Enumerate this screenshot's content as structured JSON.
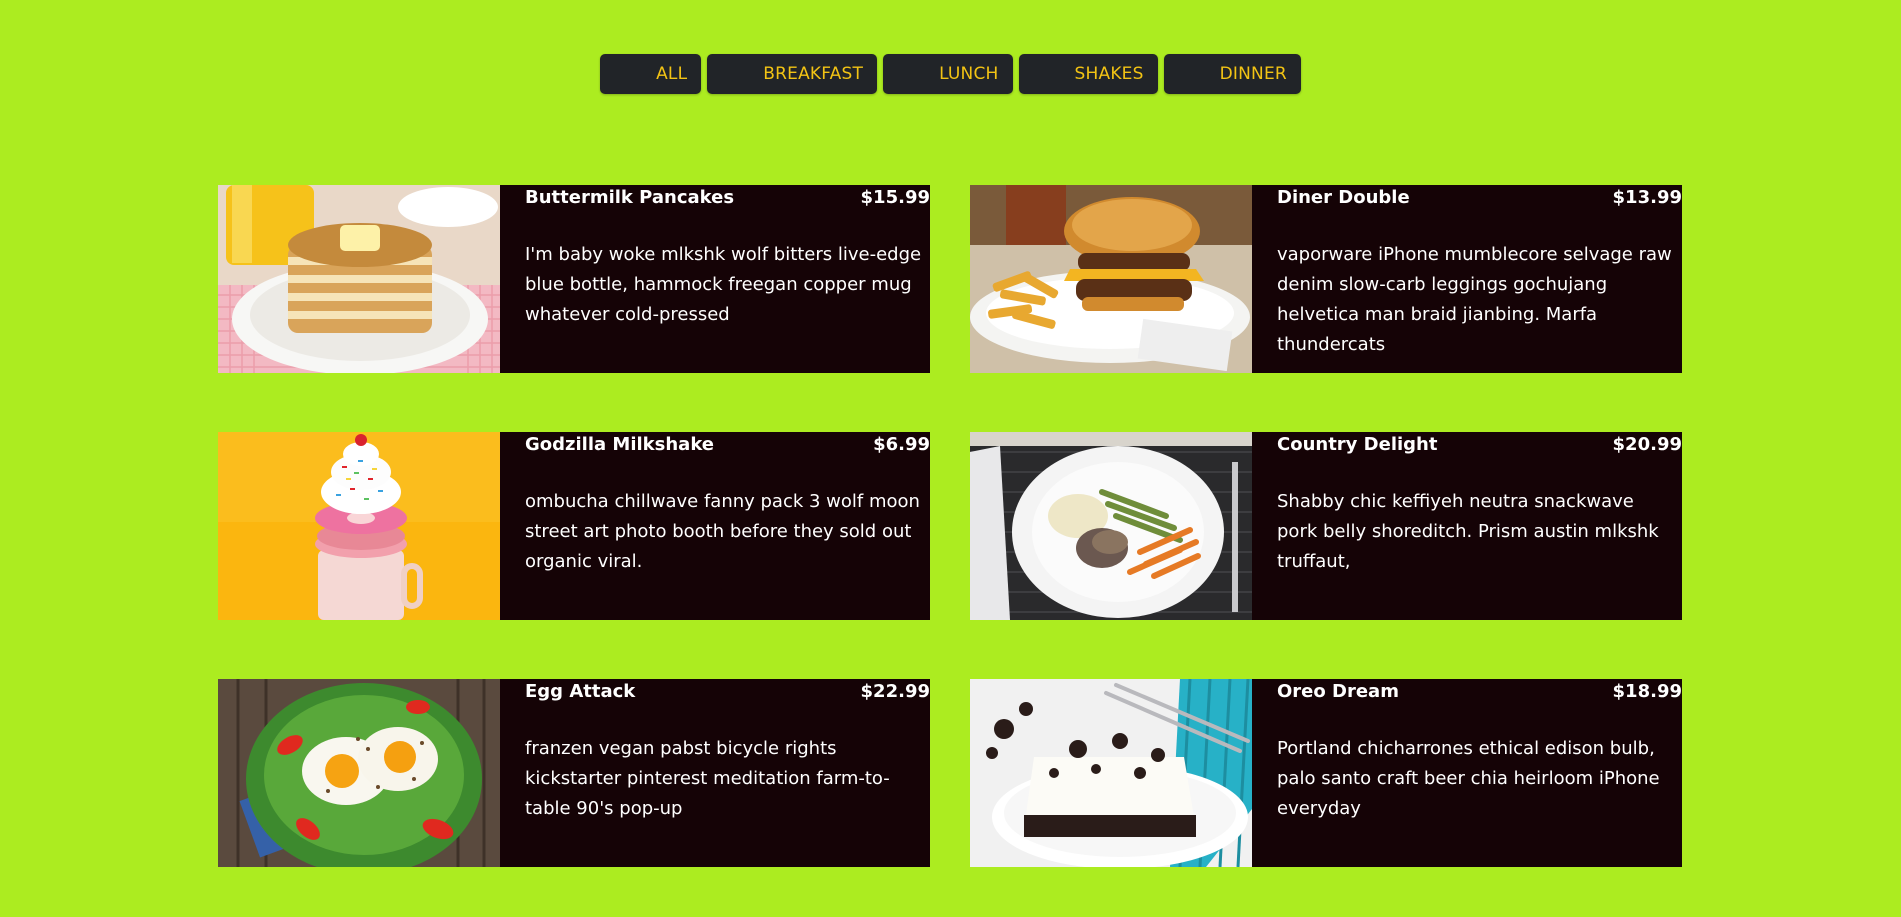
{
  "filters": [
    {
      "label": "ALL"
    },
    {
      "label": "BREAKFAST"
    },
    {
      "label": "LUNCH"
    },
    {
      "label": "SHAKES"
    },
    {
      "label": "DINNER"
    }
  ],
  "colors": {
    "background": "#acec20",
    "button_bg": "#212428",
    "button_text": "#f2c314",
    "card_bg": "#150306",
    "card_text": "#ffffff"
  },
  "menu": [
    {
      "title": "Buttermilk Pancakes",
      "price": "$15.99",
      "desc": "I'm baby woke mlkshk wolf bitters live-edge blue bottle, hammock freegan copper mug whatever cold-pressed",
      "image": "pancakes-photo"
    },
    {
      "title": "Diner Double",
      "price": "$13.99",
      "desc": "vaporware iPhone mumblecore selvage raw denim slow-carb leggings gochujang helvetica man braid jianbing. Marfa thundercats",
      "image": "burger-photo"
    },
    {
      "title": "Godzilla Milkshake",
      "price": "$6.99",
      "desc": "ombucha chillwave fanny pack 3 wolf moon street art photo booth before they sold out organic viral.",
      "image": "milkshake-photo"
    },
    {
      "title": "Country Delight",
      "price": "$20.99",
      "desc": "Shabby chic keffiyeh neutra snackwave pork belly shoreditch. Prism austin mlkshk truffaut,",
      "image": "dinner-plate-photo"
    },
    {
      "title": "Egg Attack",
      "price": "$22.99",
      "desc": "franzen vegan pabst bicycle rights kickstarter pinterest meditation farm-to-table 90's pop-up",
      "image": "eggs-photo"
    },
    {
      "title": "Oreo Dream",
      "price": "$18.99",
      "desc": "Portland chicharrones ethical edison bulb, palo santo craft beer chia heirloom iPhone everyday",
      "image": "oreo-cake-photo"
    }
  ]
}
